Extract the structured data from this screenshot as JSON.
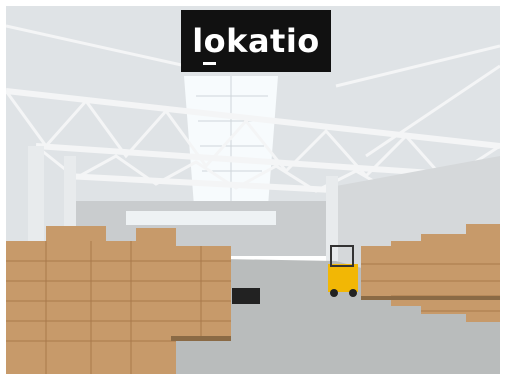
{
  "brand": {
    "logo_text": "lokatio"
  },
  "scene": {
    "colors": {
      "ceiling": "#dfe3e6",
      "truss": "#f4f5f6",
      "skylight": "#f7fbfd",
      "floor": "#b9bcbc",
      "wall": "#c9ccce",
      "box": "#c79a6a",
      "box_dark": "#a8794b",
      "forklift": "#f2b705",
      "pallet": "#8a6a45"
    },
    "icons": [
      "forklift-icon",
      "pallet-stack-icon"
    ]
  }
}
